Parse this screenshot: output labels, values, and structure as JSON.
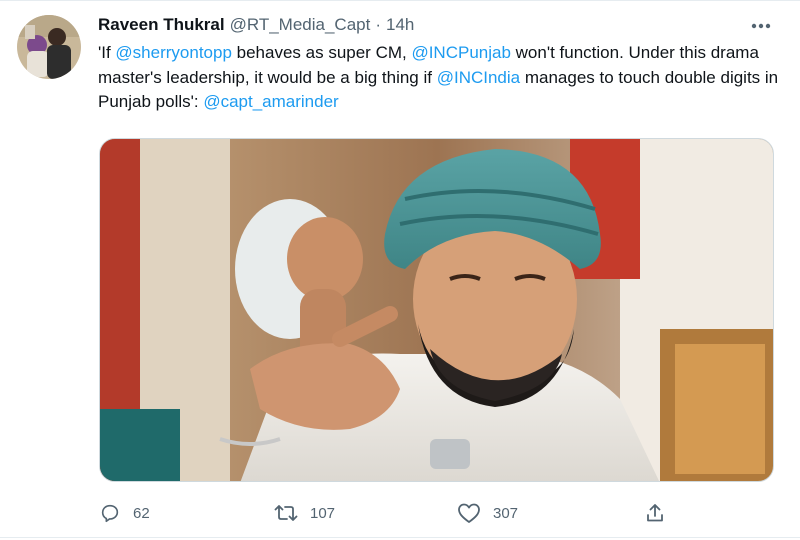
{
  "tweet": {
    "author_name": "Raveen Thukral",
    "handle": "@RT_Media_Capt",
    "separator": "·",
    "time": "14h",
    "text_parts": {
      "t1": "'If ",
      "m1": "@sherryontopp",
      "t2": " behaves as super CM, ",
      "m2": "@INCPunjab",
      "t3": " won't function. Under this drama master's leadership, it would be a big thing if ",
      "m3": "@INCIndia",
      "t4": " manages to touch double digits in Punjab polls': ",
      "m4": "@capt_amarinder"
    },
    "mention_color": "#1d9bf0"
  },
  "actions": {
    "replies": "62",
    "retweets": "107",
    "likes": "307"
  },
  "icons": {
    "more": "more-horizontal-icon",
    "reply": "reply-bubble-icon",
    "retweet": "retweet-arrows-icon",
    "like": "heart-icon",
    "share": "share-upload-icon"
  }
}
